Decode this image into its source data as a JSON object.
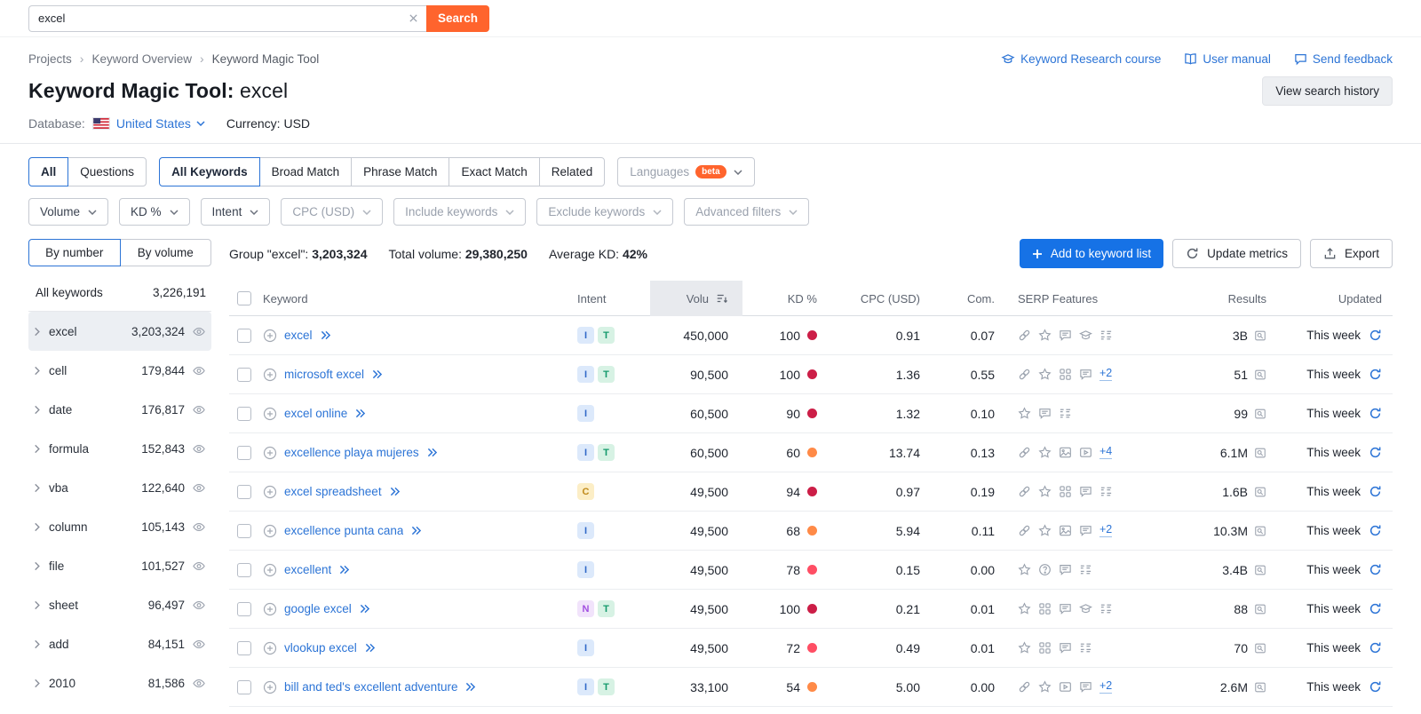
{
  "topbar": {
    "search_value": "excel",
    "search_button": "Search"
  },
  "breadcrumb": [
    "Projects",
    "Keyword Overview",
    "Keyword Magic Tool"
  ],
  "header_links": [
    {
      "icon": "course-icon",
      "label": "Keyword Research course"
    },
    {
      "icon": "book-icon",
      "label": "User manual"
    },
    {
      "icon": "feedback-icon",
      "label": "Send feedback"
    }
  ],
  "page": {
    "title": "Keyword Magic Tool:",
    "query": "excel",
    "history_button": "View search history",
    "database_label": "Database:",
    "database_value": "United States",
    "currency": "Currency: USD"
  },
  "tabs": [
    {
      "label": "All",
      "group": 1,
      "selected": true
    },
    {
      "label": "Questions",
      "group": 1
    },
    {
      "label": "All Keywords",
      "group": 2,
      "selected": true
    },
    {
      "label": "Broad Match",
      "group": 2
    },
    {
      "label": "Phrase Match",
      "group": 2
    },
    {
      "label": "Exact Match",
      "group": 2
    },
    {
      "label": "Related",
      "group": 2
    },
    {
      "label": "Languages",
      "group": 3,
      "muted": true,
      "beta": "beta",
      "caret": true
    }
  ],
  "filters": [
    {
      "label": "Volume"
    },
    {
      "label": "KD %"
    },
    {
      "label": "Intent"
    },
    {
      "label": "CPC (USD)",
      "muted": true
    },
    {
      "label": "Include keywords",
      "muted": true
    },
    {
      "label": "Exclude keywords",
      "muted": true
    },
    {
      "label": "Advanced filters",
      "muted": true
    }
  ],
  "sidebar": {
    "toggle": [
      {
        "label": "By number",
        "selected": true
      },
      {
        "label": "By volume",
        "selected": false
      }
    ],
    "all_row": {
      "label": "All keywords",
      "count": "3,226,191"
    },
    "groups": [
      {
        "label": "excel",
        "count": "3,203,324",
        "selected": true
      },
      {
        "label": "cell",
        "count": "179,844"
      },
      {
        "label": "date",
        "count": "176,817"
      },
      {
        "label": "formula",
        "count": "152,843"
      },
      {
        "label": "vba",
        "count": "122,640"
      },
      {
        "label": "column",
        "count": "105,143"
      },
      {
        "label": "file",
        "count": "101,527"
      },
      {
        "label": "sheet",
        "count": "96,497"
      },
      {
        "label": "add",
        "count": "84,151"
      },
      {
        "label": "2010",
        "count": "81,586"
      }
    ]
  },
  "summary": {
    "group_label": "Group \"excel\":",
    "group_value": "3,203,324",
    "volume_label": "Total volume:",
    "volume_value": "29,380,250",
    "kd_label": "Average KD:",
    "kd_value": "42%",
    "add_button": "Add to keyword list",
    "update_button": "Update metrics",
    "export_button": "Export"
  },
  "colors": {
    "accent_orange": "#ff642d",
    "link_blue": "#2c74d6",
    "primary_blue": "#1672e6",
    "kd": {
      "very_hard": "#cc1e47",
      "hard": "#ff4e64",
      "difficult": "#ff8a47"
    }
  },
  "table": {
    "columns": {
      "keyword": "Keyword",
      "intent": "Intent",
      "volume": "Volu",
      "kd": "KD %",
      "cpc": "CPC (USD)",
      "com": "Com.",
      "serp": "SERP Features",
      "results": "Results",
      "updated": "Updated"
    },
    "rows": [
      {
        "keyword": "excel",
        "intents": [
          {
            "label": "I",
            "type": "info"
          },
          {
            "label": "T",
            "type": "trans"
          }
        ],
        "volume": "450,000",
        "kd": "100",
        "kd_level": "very_hard",
        "cpc": "0.91",
        "com": "0.07",
        "serp_icons": [
          "link-icon",
          "star-icon",
          "reviews-icon",
          "knowledge-icon",
          "sitelinks-icon"
        ],
        "serp_more": "",
        "results": "3B",
        "updated": "This week"
      },
      {
        "keyword": "microsoft excel",
        "intents": [
          {
            "label": "I",
            "type": "info"
          },
          {
            "label": "T",
            "type": "trans"
          }
        ],
        "volume": "90,500",
        "kd": "100",
        "kd_level": "very_hard",
        "cpc": "1.36",
        "com": "0.55",
        "serp_icons": [
          "link-icon",
          "star-icon",
          "grid-icon",
          "reviews-icon"
        ],
        "serp_more": "+2",
        "results": "51",
        "updated": "This week"
      },
      {
        "keyword": "excel online",
        "intents": [
          {
            "label": "I",
            "type": "info"
          }
        ],
        "volume": "60,500",
        "kd": "90",
        "kd_level": "very_hard",
        "cpc": "1.32",
        "com": "0.10",
        "serp_icons": [
          "star-icon",
          "reviews-icon",
          "sitelinks-icon"
        ],
        "serp_more": "",
        "results": "99",
        "updated": "This week"
      },
      {
        "keyword": "excellence playa mujeres",
        "intents": [
          {
            "label": "I",
            "type": "info"
          },
          {
            "label": "T",
            "type": "trans"
          }
        ],
        "volume": "60,500",
        "kd": "60",
        "kd_level": "difficult",
        "cpc": "13.74",
        "com": "0.13",
        "serp_icons": [
          "link-icon",
          "star-icon",
          "image-icon",
          "video-icon"
        ],
        "serp_more": "+4",
        "results": "6.1M",
        "updated": "This week"
      },
      {
        "keyword": "excel spreadsheet",
        "intents": [
          {
            "label": "C",
            "type": "comm"
          }
        ],
        "volume": "49,500",
        "kd": "94",
        "kd_level": "very_hard",
        "cpc": "0.97",
        "com": "0.19",
        "serp_icons": [
          "link-icon",
          "star-icon",
          "grid-icon",
          "reviews-icon",
          "sitelinks-icon"
        ],
        "serp_more": "",
        "results": "1.6B",
        "updated": "This week"
      },
      {
        "keyword": "excellence punta cana",
        "intents": [
          {
            "label": "I",
            "type": "info"
          }
        ],
        "volume": "49,500",
        "kd": "68",
        "kd_level": "difficult",
        "cpc": "5.94",
        "com": "0.11",
        "serp_icons": [
          "link-icon",
          "star-icon",
          "image-icon",
          "reviews-icon"
        ],
        "serp_more": "+2",
        "results": "10.3M",
        "updated": "This week"
      },
      {
        "keyword": "excellent",
        "intents": [
          {
            "label": "I",
            "type": "info"
          }
        ],
        "volume": "49,500",
        "kd": "78",
        "kd_level": "hard",
        "cpc": "0.15",
        "com": "0.00",
        "serp_icons": [
          "star-icon",
          "question-icon",
          "reviews-icon",
          "sitelinks-icon"
        ],
        "serp_more": "",
        "results": "3.4B",
        "updated": "This week"
      },
      {
        "keyword": "google excel",
        "intents": [
          {
            "label": "N",
            "type": "nav"
          },
          {
            "label": "T",
            "type": "trans"
          }
        ],
        "volume": "49,500",
        "kd": "100",
        "kd_level": "very_hard",
        "cpc": "0.21",
        "com": "0.01",
        "serp_icons": [
          "star-icon",
          "grid-icon",
          "reviews-icon",
          "knowledge-icon",
          "sitelinks-icon"
        ],
        "serp_more": "",
        "results": "88",
        "updated": "This week"
      },
      {
        "keyword": "vlookup excel",
        "intents": [
          {
            "label": "I",
            "type": "info"
          }
        ],
        "volume": "49,500",
        "kd": "72",
        "kd_level": "hard",
        "cpc": "0.49",
        "com": "0.01",
        "serp_icons": [
          "star-icon",
          "grid-icon",
          "reviews-icon",
          "sitelinks-icon"
        ],
        "serp_more": "",
        "results": "70",
        "updated": "This week"
      },
      {
        "keyword": "bill and ted's excellent adventure",
        "intents": [
          {
            "label": "I",
            "type": "info"
          },
          {
            "label": "T",
            "type": "trans"
          }
        ],
        "volume": "33,100",
        "kd": "54",
        "kd_level": "difficult",
        "cpc": "5.00",
        "com": "0.00",
        "serp_icons": [
          "link-icon",
          "star-icon",
          "video-icon",
          "reviews-icon"
        ],
        "serp_more": "+2",
        "results": "2.6M",
        "updated": "This week"
      }
    ]
  }
}
